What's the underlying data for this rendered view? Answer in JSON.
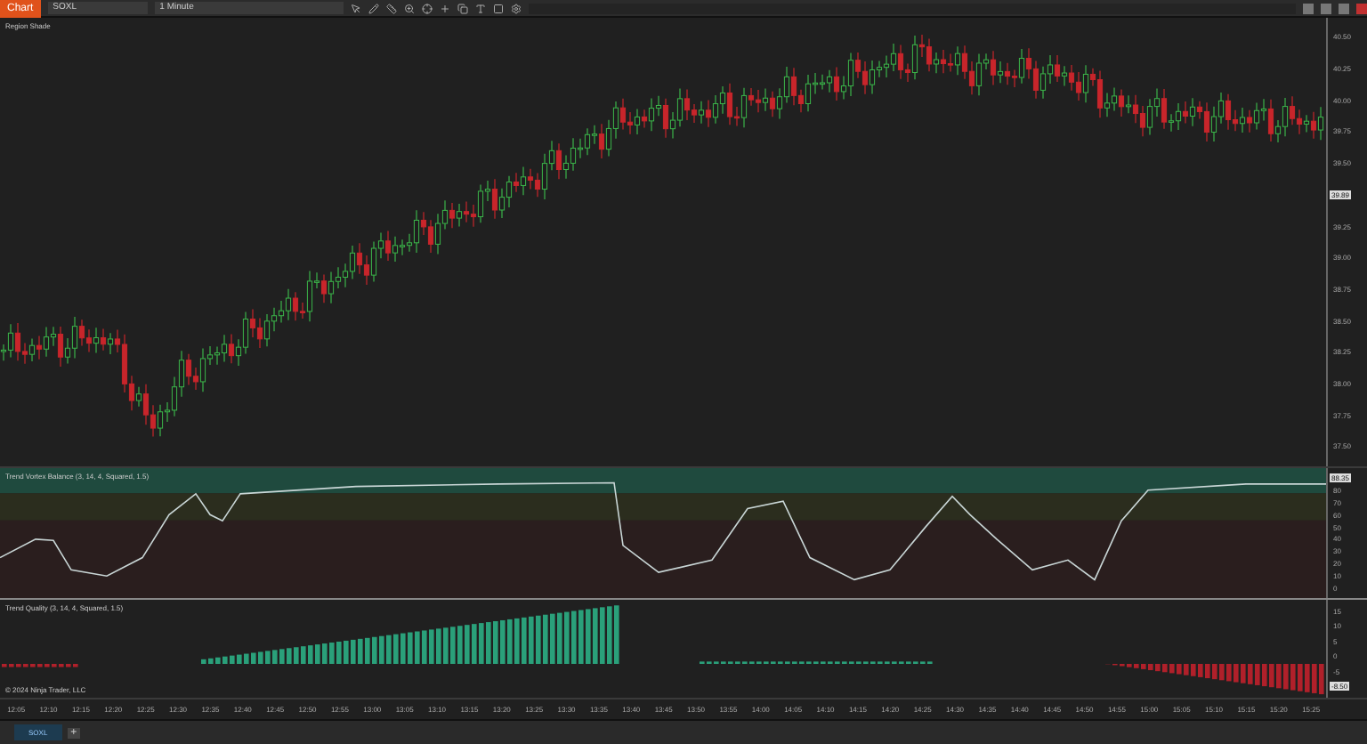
{
  "window": {
    "title": "Chart",
    "instrument": "SOXL",
    "interval": "1 Minute"
  },
  "price_panel": {
    "label": "Region Shade",
    "axis": [
      "40.50",
      "40.25",
      "40.00",
      "39.75",
      "39.50",
      "39.25",
      "39.00",
      "38.75",
      "38.50",
      "38.25",
      "38.00",
      "37.75",
      "37.50"
    ],
    "last_price": "39.89"
  },
  "oscillator_panel": {
    "label": "Trend Vortex Balance (3, 14, 4, Squared, 1.5)",
    "axis": [
      "80",
      "70",
      "60",
      "50",
      "40",
      "30",
      "20",
      "10",
      "0"
    ],
    "last_value": "88.35"
  },
  "quality_panel": {
    "label": "Trend Quality (3, 14, 4, Squared, 1.5)",
    "axis": [
      "15",
      "10",
      "5",
      "0",
      "-5"
    ],
    "last_value": "-8.50",
    "copyright": "© 2024 Ninja Trader, LLC"
  },
  "time_axis": [
    "12:05",
    "12:10",
    "12:15",
    "12:20",
    "12:25",
    "12:30",
    "12:35",
    "12:40",
    "12:45",
    "12:50",
    "12:55",
    "13:00",
    "13:05",
    "13:10",
    "13:15",
    "13:20",
    "13:25",
    "13:30",
    "13:35",
    "13:40",
    "13:45",
    "13:50",
    "13:55",
    "14:00",
    "14:05",
    "14:10",
    "14:15",
    "14:20",
    "14:25",
    "14:30",
    "14:35",
    "14:40",
    "14:45",
    "14:50",
    "14:55",
    "15:00",
    "15:05",
    "15:10",
    "15:15",
    "15:20",
    "15:25"
  ],
  "tabs": [
    {
      "label": "SOXL",
      "selected": true
    }
  ],
  "add_tab": "+"
}
